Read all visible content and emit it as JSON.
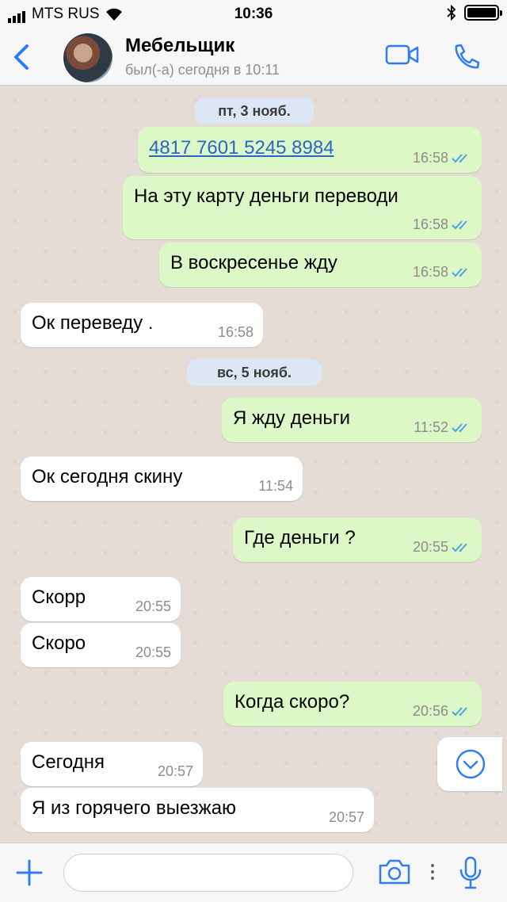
{
  "status_bar": {
    "carrier": "MTS RUS",
    "time": "10:36"
  },
  "header": {
    "contact_name": "Мебельщик",
    "last_seen": "был(-а) сегодня в 10:11"
  },
  "date_separators": [
    "пт, 3 нояб.",
    "вс, 5 нояб."
  ],
  "messages": [
    {
      "dir": "out",
      "text": "4817 7601 5245 8984",
      "time": "16:58",
      "is_link": true
    },
    {
      "dir": "out",
      "text": "На эту карту деньги переводи",
      "time": "16:58"
    },
    {
      "dir": "out",
      "text": "В воскресенье жду",
      "time": "16:58"
    },
    {
      "dir": "in",
      "text": "Ок переведу .",
      "time": "16:58"
    },
    {
      "dir": "out",
      "text": "Я жду деньги",
      "time": "11:52"
    },
    {
      "dir": "in",
      "text": "Ок сегодня скину",
      "time": "11:54"
    },
    {
      "dir": "out",
      "text": "Где деньги ?",
      "time": "20:55"
    },
    {
      "dir": "in",
      "text": "Скорр",
      "time": "20:55"
    },
    {
      "dir": "in",
      "text": "Скоро",
      "time": "20:55"
    },
    {
      "dir": "out",
      "text": "Когда скоро?",
      "time": "20:56"
    },
    {
      "dir": "in",
      "text": "Сегодня",
      "time": "20:57"
    },
    {
      "dir": "in",
      "text": "Я из горячего выезжаю",
      "time": "20:57"
    }
  ],
  "input": {
    "placeholder": ""
  },
  "colors": {
    "accent": "#2f7cf6",
    "outgoing_bubble": "#dcf8c6",
    "incoming_bubble": "#ffffff",
    "read_ticks": "#4fa3e0",
    "date_pill": "#dde6f5"
  },
  "icons": [
    "back-chevron-icon",
    "video-call-icon",
    "phone-call-icon",
    "double-check-icon",
    "scroll-down-icon",
    "plus-icon",
    "camera-icon",
    "mic-icon"
  ]
}
